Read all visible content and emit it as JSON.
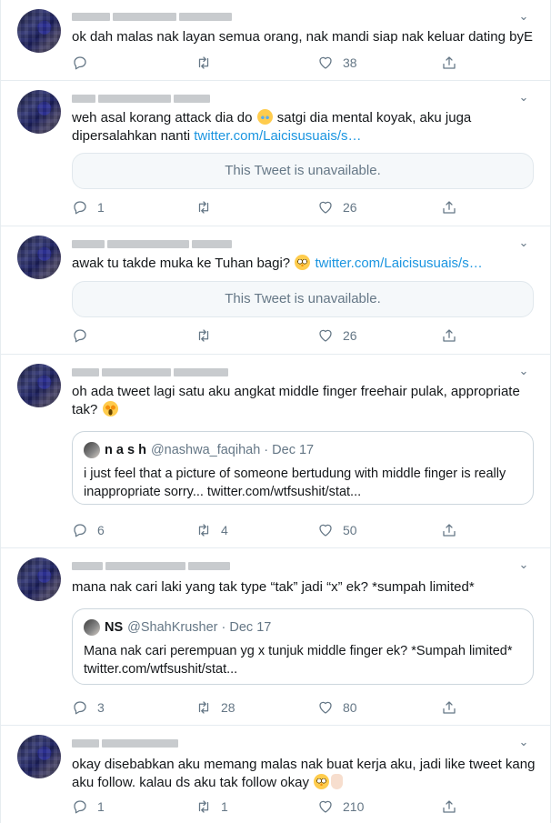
{
  "colors": {
    "link": "#1b95e0",
    "secondary": "#657786",
    "border": "#e6ecf0",
    "text": "#14171a"
  },
  "unavailable_text": "This Tweet is unavailable.",
  "tweets": [
    {
      "text": "ok dah malas nak layan semua orang, nak mandi siap nak keluar dating byE",
      "replies": "",
      "retweets": "",
      "likes": "38"
    },
    {
      "text_before": "weh asal korang attack dia do ",
      "text_after": " satgi dia mental koyak, aku juga dipersalahkan nanti ",
      "link": "twitter.com/Laicisusuais/s…",
      "replies": "1",
      "retweets": "",
      "likes": "26"
    },
    {
      "text_before": "awak tu takde muka ke Tuhan bagi? ",
      "link": "twitter.com/Laicisusuais/s…",
      "replies": "",
      "retweets": "",
      "likes": "26"
    },
    {
      "text_before": "oh ada tweet lagi satu aku angkat middle finger freehair pulak, appropriate tak? ",
      "quote": {
        "name": "n a s h",
        "handle": "@nashwa_faqihah · Dec 17",
        "text": "i just feel that a picture of someone bertudung with middle finger is really inappropriate sorry... twitter.com/wtfsushit/stat..."
      },
      "replies": "6",
      "retweets": "4",
      "likes": "50"
    },
    {
      "text": "mana nak cari laki yang tak type “tak” jadi “x” ek? *sumpah limited*",
      "quote": {
        "name": "NS",
        "handle": "@ShahKrusher · Dec 17",
        "text": "Mana nak cari perempuan yg x tunjuk middle finger ek? *Sumpah limited* twitter.com/wtfsushit/stat..."
      },
      "replies": "3",
      "retweets": "28",
      "likes": "80"
    },
    {
      "text_before": "okay disebabkan aku memang malas nak buat kerja aku, jadi like tweet kang aku follow. kalau ds aku tak follow okay ",
      "replies": "1",
      "retweets": "1",
      "likes": "210"
    }
  ]
}
